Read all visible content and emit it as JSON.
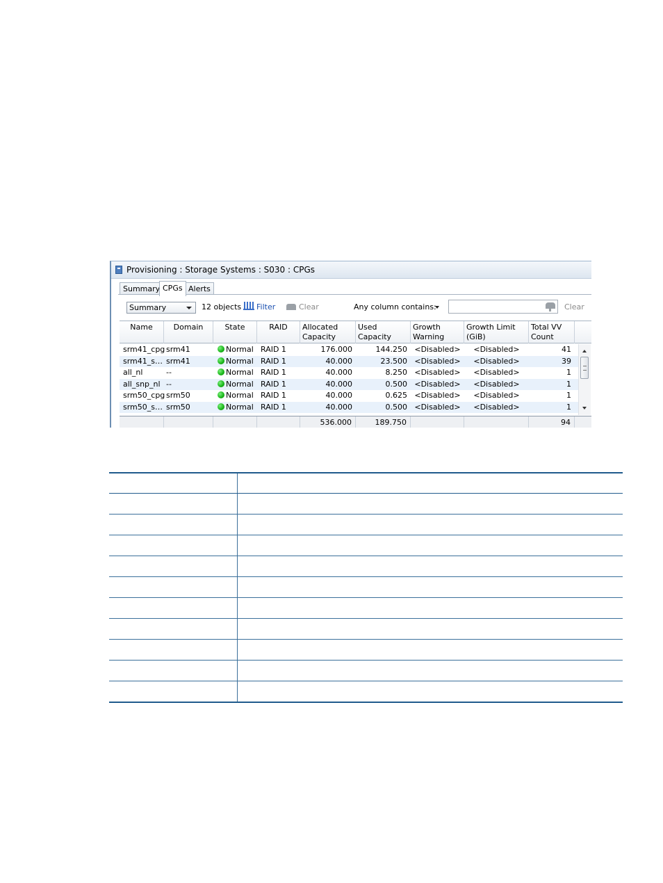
{
  "window": {
    "title": "Provisioning : Storage Systems : S030 : CPGs"
  },
  "tabs": [
    {
      "label": "Summary",
      "active": false
    },
    {
      "label": "CPGs",
      "active": true
    },
    {
      "label": "Alerts",
      "active": false
    }
  ],
  "toolbar": {
    "view_select": "Summary",
    "object_count": "12 objects",
    "filter_label": "Filter",
    "clear_label": "Clear",
    "any_column_label": "Any column contains:",
    "search_value": "",
    "search_clear_label": "Clear"
  },
  "grid": {
    "columns": [
      {
        "label": "Name"
      },
      {
        "label": "Domain"
      },
      {
        "label": "State"
      },
      {
        "label": "RAID"
      },
      {
        "label": "Allocated Capacity (GiB)"
      },
      {
        "label": "Used Capacity (GiB)"
      },
      {
        "label": "Growth Warning (GiB)"
      },
      {
        "label": "Growth Limit (GiB)"
      },
      {
        "label": "Total VV Count"
      }
    ],
    "rows": [
      {
        "name": "srm41_cpg",
        "domain": "srm41",
        "state": "Normal",
        "raid": "RAID 1",
        "allocated": "176.000",
        "used": "144.250",
        "warning": "<Disabled>",
        "limit": "<Disabled>",
        "vv": "41"
      },
      {
        "name": "srm41_s…",
        "domain": "srm41",
        "state": "Normal",
        "raid": "RAID 1",
        "allocated": "40.000",
        "used": "23.500",
        "warning": "<Disabled>",
        "limit": "<Disabled>",
        "vv": "39"
      },
      {
        "name": "all_nl",
        "domain": "--",
        "state": "Normal",
        "raid": "RAID 1",
        "allocated": "40.000",
        "used": "8.250",
        "warning": "<Disabled>",
        "limit": "<Disabled>",
        "vv": "1"
      },
      {
        "name": "all_snp_nl",
        "domain": "--",
        "state": "Normal",
        "raid": "RAID 1",
        "allocated": "40.000",
        "used": "0.500",
        "warning": "<Disabled>",
        "limit": "<Disabled>",
        "vv": "1"
      },
      {
        "name": "srm50_cpg",
        "domain": "srm50",
        "state": "Normal",
        "raid": "RAID 1",
        "allocated": "40.000",
        "used": "0.625",
        "warning": "<Disabled>",
        "limit": "<Disabled>",
        "vv": "1"
      },
      {
        "name": "srm50_s…",
        "domain": "srm50",
        "state": "Normal",
        "raid": "RAID 1",
        "allocated": "40.000",
        "used": "0.500",
        "warning": "<Disabled>",
        "limit": "<Disabled>",
        "vv": "1"
      }
    ],
    "totals": {
      "allocated": "536.000",
      "used": "189.750",
      "vv": "94"
    },
    "state_color": "#18b418"
  },
  "icons": {
    "title": "window-icon",
    "filter": "filter-icon",
    "clear": "eraser-icon",
    "search": "search-icon"
  }
}
